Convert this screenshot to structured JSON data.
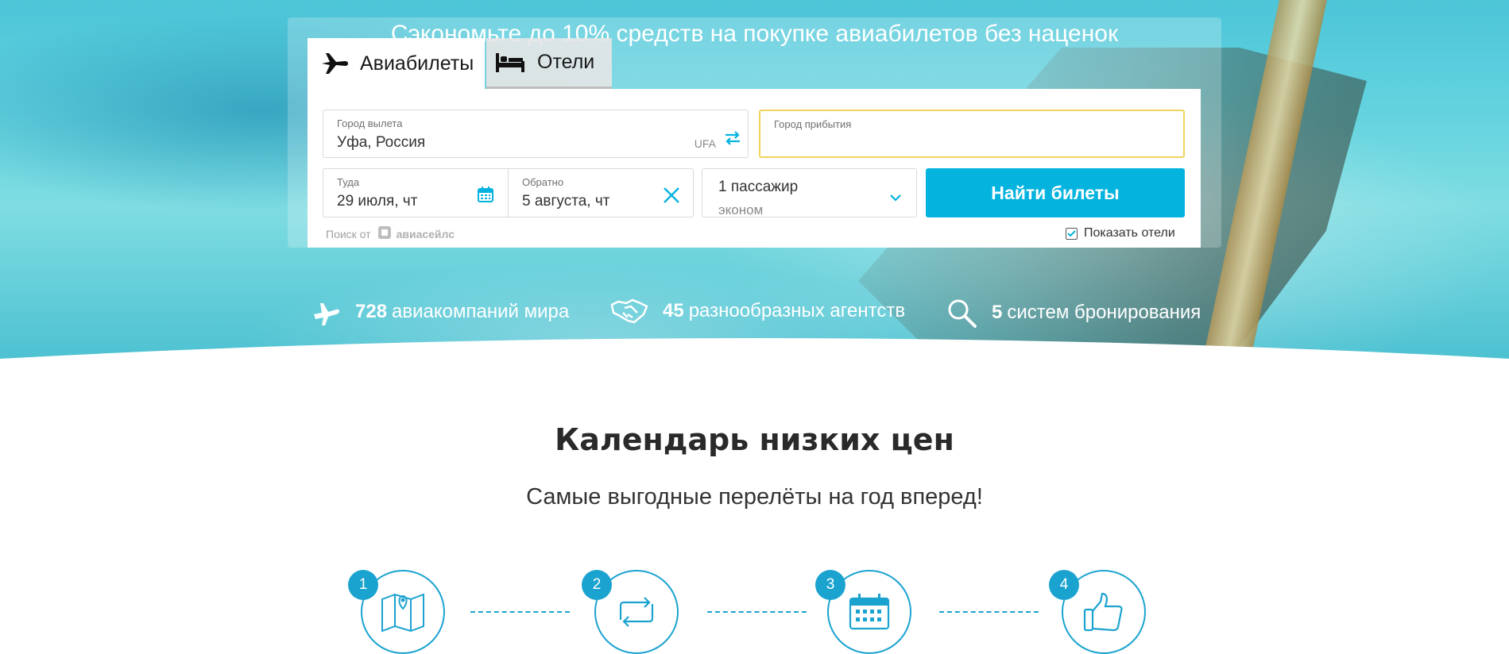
{
  "hero": {
    "tagline": "Сэкономьте до 10% средств на покупке авиабилетов без наценок"
  },
  "tabs": [
    {
      "label": "Авиабилеты",
      "icon": "plane-icon",
      "active": true
    },
    {
      "label": "Отели",
      "icon": "bed-icon",
      "active": false
    }
  ],
  "form": {
    "origin": {
      "label": "Город вылета",
      "value": "Уфа, Россия",
      "code": "UFA"
    },
    "destination": {
      "label": "Город прибытия",
      "value": ""
    },
    "depart": {
      "label": "Туда",
      "value": "29 июля, чт"
    },
    "return": {
      "label": "Обратно",
      "value": "5 августа, чт"
    },
    "passengers": {
      "value": "1 пассажир",
      "class": "эконом"
    },
    "search_button": "Найти билеты",
    "powered_by": "Поиск от",
    "powered_brand": "авиасейлс",
    "show_hotels": "Показать отели",
    "show_hotels_checked": true
  },
  "stats": [
    {
      "number": "728",
      "text": "авиакомпаний мира",
      "icon": "plane-icon"
    },
    {
      "number": "45",
      "text": "разнообразных агентств",
      "icon": "handshake-icon"
    },
    {
      "number": "5",
      "text": "систем бронирования",
      "icon": "magnifier-icon"
    }
  ],
  "calendar": {
    "title": "Календарь низких цен",
    "subtitle": "Самые выгодные перелёты на год вперед!",
    "steps": [
      {
        "number": "1",
        "icon": "map-pin-icon"
      },
      {
        "number": "2",
        "icon": "swap-arrows-icon"
      },
      {
        "number": "3",
        "icon": "calendar-icon"
      },
      {
        "number": "4",
        "icon": "thumbs-up-icon"
      }
    ]
  },
  "colors": {
    "accent": "#05b3df",
    "step_accent": "#1ba3d0",
    "destination_highlight": "#f2d35c"
  }
}
